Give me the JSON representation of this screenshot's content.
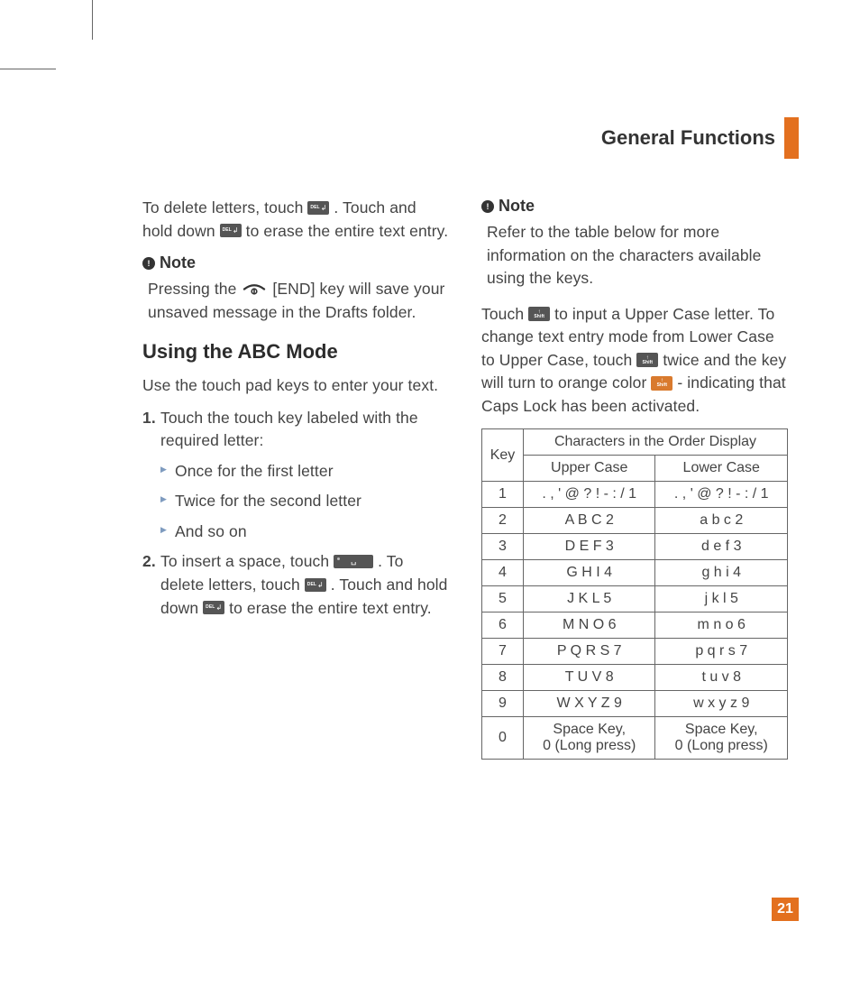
{
  "header": {
    "title": "General Functions"
  },
  "page_number": "21",
  "left": {
    "intro_a": "To delete letters, touch ",
    "intro_b": ". Touch and hold down ",
    "intro_c": " to erase the entire text entry.",
    "note_label": "Note",
    "note_a": "Pressing the ",
    "note_b": "[END] key will save your unsaved message in the Drafts folder.",
    "h2": "Using the ABC Mode",
    "p1": "Use the touch pad keys to enter your text.",
    "li1": "Touch the touch key labeled with the required letter:",
    "sub1": "Once for the first letter",
    "sub2": "Twice for the second letter",
    "sub3": "And so on",
    "li2_a": "To insert a space, touch ",
    "li2_b": ". To delete letters, touch ",
    "li2_c": ". Touch and hold down ",
    "li2_d": " to erase the entire text entry."
  },
  "right": {
    "note_label": "Note",
    "note_body": "Refer to the table below for more information on the characters available using the keys.",
    "p_a": "Touch ",
    "p_b": " to input a Upper Case letter. To change text entry mode from Lower Case to Upper Case, touch ",
    "p_c": " twice and the key will turn to orange color ",
    "p_d": " - indicating that Caps Lock has been activated."
  },
  "chart_data": {
    "type": "table",
    "title": "Characters in the Order Display",
    "key_header": "Key",
    "columns": [
      "Upper Case",
      "Lower Case"
    ],
    "rows": [
      {
        "key": "1",
        "upper": ". , ' @ ? ! - : / 1",
        "lower": ". , ' @ ? ! - : / 1"
      },
      {
        "key": "2",
        "upper": "A B C 2",
        "lower": "a b c 2"
      },
      {
        "key": "3",
        "upper": "D E F 3",
        "lower": "d e f 3"
      },
      {
        "key": "4",
        "upper": "G H I 4",
        "lower": "g h i 4"
      },
      {
        "key": "5",
        "upper": "J K L 5",
        "lower": "j k l 5"
      },
      {
        "key": "6",
        "upper": "M N O 6",
        "lower": "m n o 6"
      },
      {
        "key": "7",
        "upper": "P Q R S 7",
        "lower": "p q r s 7"
      },
      {
        "key": "8",
        "upper": "T U V 8",
        "lower": "t u v 8"
      },
      {
        "key": "9",
        "upper": "W X Y Z 9",
        "lower": "w x y z 9"
      },
      {
        "key": "0",
        "upper": "Space Key,\n0 (Long press)",
        "lower": "Space Key,\n0 (Long press)"
      }
    ]
  }
}
